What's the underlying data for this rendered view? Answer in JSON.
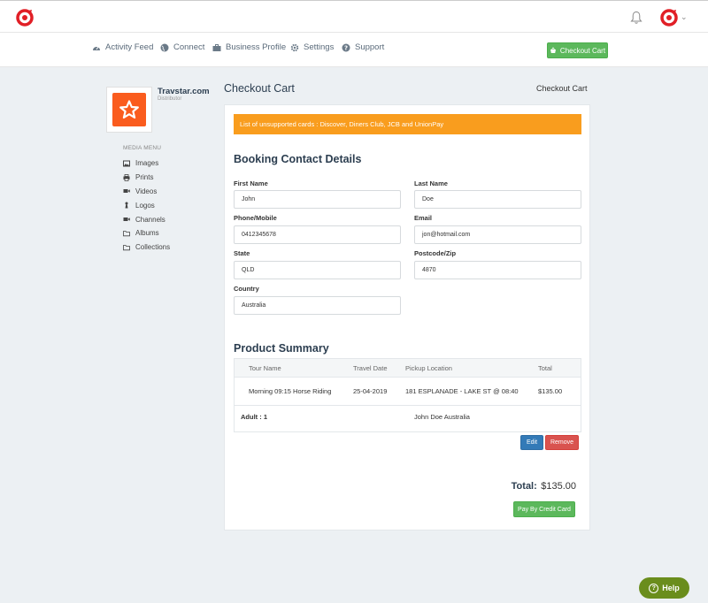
{
  "header": {
    "brand_color": "#e11f26"
  },
  "nav": {
    "items": [
      {
        "label": "Activity Feed",
        "icon": "dashboard-icon"
      },
      {
        "label": "Connect",
        "icon": "globe-icon"
      },
      {
        "label": "Business Profile",
        "icon": "briefcase-icon"
      },
      {
        "label": "Settings",
        "icon": "gear-icon"
      },
      {
        "label": "Support",
        "icon": "question-circle-icon"
      }
    ],
    "checkout_label": "Checkout Cart"
  },
  "profile": {
    "name": "Travstar.com",
    "role": "Distributor"
  },
  "media_menu": {
    "title": "MEDIA MENU",
    "items": [
      {
        "label": "Images",
        "icon": "image-icon"
      },
      {
        "label": "Prints",
        "icon": "printer-icon"
      },
      {
        "label": "Videos",
        "icon": "video-icon"
      },
      {
        "label": "Logos",
        "icon": "pawn-icon"
      },
      {
        "label": "Channels",
        "icon": "video-icon"
      },
      {
        "label": "Albums",
        "icon": "folder-icon"
      },
      {
        "label": "Collections",
        "icon": "folder-icon"
      }
    ]
  },
  "page": {
    "title": "Checkout Cart",
    "breadcrumb": "Checkout Cart"
  },
  "alert": {
    "text": "List of unsupported cards : Discover, Diners Club, JCB and UnionPay",
    "color": "#f99d1e"
  },
  "contact": {
    "heading": "Booking Contact Details",
    "first_name": {
      "label": "First Name",
      "value": "John"
    },
    "last_name": {
      "label": "Last Name",
      "value": "Doe"
    },
    "phone": {
      "label": "Phone/Mobile",
      "value": "0412345678"
    },
    "email": {
      "label": "Email",
      "value": "jon@hotmail.com"
    },
    "state": {
      "label": "State",
      "value": "QLD"
    },
    "postcode": {
      "label": "Postcode/Zip",
      "value": "4870"
    },
    "country": {
      "label": "Country",
      "value": "Australia"
    }
  },
  "summary": {
    "heading": "Product Summary",
    "columns": [
      "Tour Name",
      "Travel Date",
      "Pickup Location",
      "Total"
    ],
    "row": {
      "tour": "Morning 09:15 Horse Riding",
      "date": "25-04-2019",
      "pickup": "181 ESPLANADE - LAKE ST @ 08:40",
      "total": "$135.00"
    },
    "pax_label": "Adult : 1",
    "pax_name": "John Doe Australia",
    "edit_label": "Edit",
    "remove_label": "Remove"
  },
  "totals": {
    "label": "Total:",
    "value": "$135.00",
    "pay_label": "Pay By Credit Card"
  },
  "help": {
    "label": "Help"
  }
}
